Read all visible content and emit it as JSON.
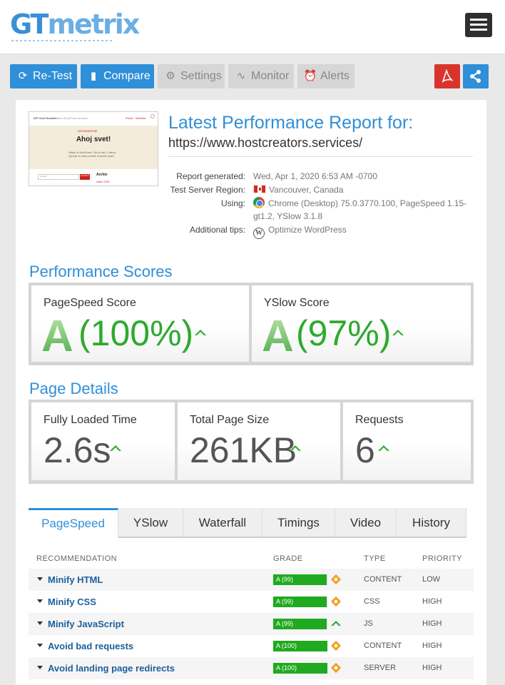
{
  "header": {
    "logo_gt": "GT",
    "logo_metrix": "metrix",
    "menu_icon": "hamburger-icon"
  },
  "toolbar": {
    "retest_label": "Re-Test",
    "compare_label": "Compare",
    "settings_label": "Settings",
    "monitor_label": "Monitor",
    "alerts_label": "Alerts",
    "pdf_icon": "pdf-icon",
    "share_icon": "share-icon"
  },
  "thumbnail": {
    "site_name": "WP Host Slovakia",
    "tagline": "Len ďalšia WordPress stránka",
    "kicker": "NEZARADENÉ",
    "menu_link": "Pravá · hlavička",
    "title": "Ahoj svet!",
    "body": "Vitajte vo WordPress. Toto je váš 1. článok. Upravte ho alebo zmažte a začnite písať!",
    "search_placeholder": "Hľadať...",
    "search_button": "HĽADAŤ",
    "archive_heading": "Archív",
    "archive_date": "marec 2020"
  },
  "report": {
    "title": "Latest Performance Report for:",
    "url": "https://www.hostcreators.services/",
    "generated_label": "Report generated:",
    "generated_value": "Wed, Apr 1, 2020 6:53 AM -0700",
    "region_label": "Test Server Region:",
    "region_value": "Vancouver, Canada",
    "using_label": "Using:",
    "using_value": "Chrome (Desktop) 75.0.3770.100, PageSpeed 1.15-gt1.2, YSlow 3.1.8",
    "tips_label": "Additional tips:",
    "tips_value": "Optimize WordPress",
    "wp_glyph": "W"
  },
  "performance": {
    "heading": "Performance Scores",
    "pagespeed_label": "PageSpeed Score",
    "pagespeed_grade": "A",
    "pagespeed_pct": "(100%)",
    "yslow_label": "YSlow Score",
    "yslow_grade": "A",
    "yslow_pct": "(97%)"
  },
  "details": {
    "heading": "Page Details",
    "load_label": "Fully Loaded Time",
    "load_value": "2.6s",
    "size_label": "Total Page Size",
    "size_value": "261KB",
    "req_label": "Requests",
    "req_value": "6"
  },
  "tabs": [
    "PageSpeed",
    "YSlow",
    "Waterfall",
    "Timings",
    "Video",
    "History"
  ],
  "table": {
    "col_recommendation": "RECOMMENDATION",
    "col_grade": "GRADE",
    "col_type": "TYPE",
    "col_priority": "PRIORITY",
    "rows": [
      {
        "name": "Minify HTML",
        "grade": "A (99)",
        "score": 99,
        "trend": "neutral",
        "type": "CONTENT",
        "priority": "LOW"
      },
      {
        "name": "Minify CSS",
        "grade": "A (99)",
        "score": 99,
        "trend": "neutral",
        "type": "CSS",
        "priority": "HIGH"
      },
      {
        "name": "Minify JavaScript",
        "grade": "A (99)",
        "score": 99,
        "trend": "up",
        "type": "JS",
        "priority": "HIGH"
      },
      {
        "name": "Avoid bad requests",
        "grade": "A (100)",
        "score": 100,
        "trend": "neutral",
        "type": "CONTENT",
        "priority": "HIGH"
      },
      {
        "name": "Avoid landing page redirects",
        "grade": "A (100)",
        "score": 100,
        "trend": "neutral",
        "type": "SERVER",
        "priority": "HIGH"
      }
    ]
  },
  "colors": {
    "accent": "#2f8fd8",
    "grade_green": "#1faa1f",
    "pdf_red": "#d9342b",
    "trend_orange": "#f0a020"
  }
}
